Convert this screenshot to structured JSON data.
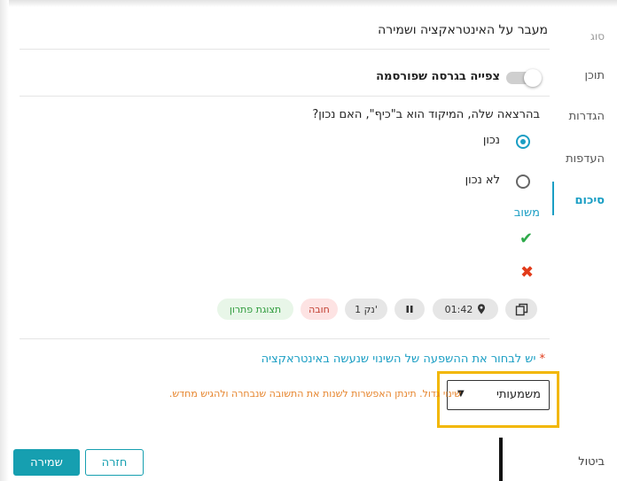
{
  "sidebar": {
    "items": [
      {
        "label": "סוג",
        "state": "muted"
      },
      {
        "label": "תוכן",
        "state": "normal"
      },
      {
        "label": "הגדרות",
        "state": "normal"
      },
      {
        "label": "העדפות",
        "state": "normal"
      },
      {
        "label": "סיכום",
        "state": "active"
      }
    ],
    "cancel_label": "ביטול"
  },
  "header": {
    "title": "מעבר על האינטראקציה ושמירה"
  },
  "preview_toggle": {
    "label": "צפייה בגרסה שפורסמה",
    "on": false
  },
  "question": {
    "text": "בהרצאה שלה, המיקוד הוא ב\"כיף\", האם נכון?",
    "options": [
      {
        "label": "נכון",
        "selected": true
      },
      {
        "label": "לא נכון",
        "selected": false
      }
    ],
    "feedback_label": "משוב",
    "correct_symbol": "✔",
    "incorrect_symbol": "✖"
  },
  "chips": {
    "copy_icon": "copy-icon",
    "time": "01:42",
    "time_icon": "location-pin-icon",
    "pause_icon": "pause-icon",
    "points": "1 נק'",
    "required": "חובה",
    "solution": "תצוגת פתרון"
  },
  "change_impact": {
    "required_star": "*",
    "message": "יש לבחור את ההשפעה של השינוי שנעשה באינטראקציה",
    "selected_value": "משמעותי",
    "warning": "שינוי גדול. תינתן האפשרות לשנות את התשובה שנבחרה ולהגיש מחדש."
  },
  "footer": {
    "save_label": "שמירה",
    "back_label": "חזרה"
  },
  "colors": {
    "accent": "#1a9ec4",
    "primary_button": "#169fb0",
    "highlight_border": "#f2b705",
    "warning_text": "#e6832a",
    "correct": "#2eaa4a",
    "incorrect": "#e23b1a"
  }
}
